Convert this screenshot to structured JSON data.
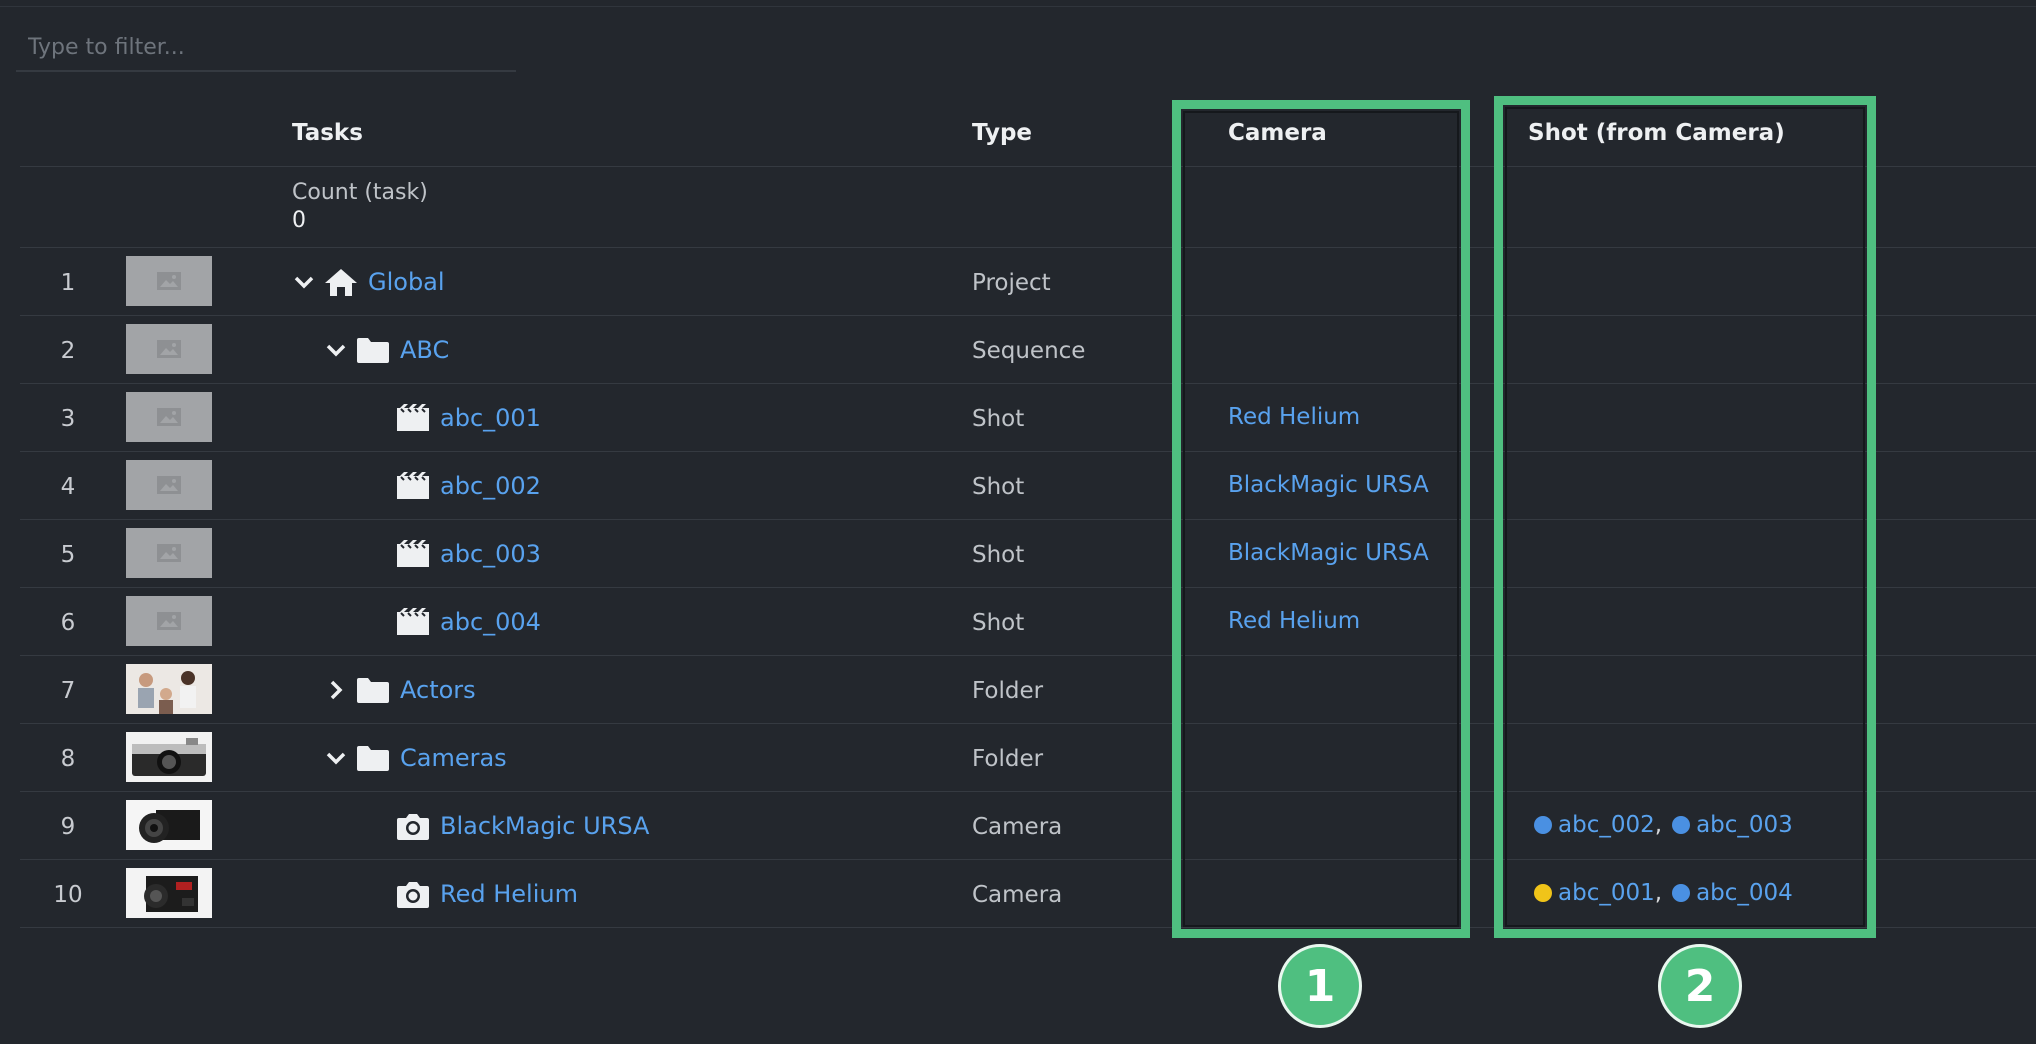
{
  "filter": {
    "placeholder": "Type to filter..."
  },
  "headers": {
    "tasks": "Tasks",
    "type": "Type",
    "camera": "Camera",
    "shot_from_camera": "Shot (from Camera)"
  },
  "summary": {
    "count_label": "Count (task)",
    "count_value": "0"
  },
  "rows": [
    {
      "num": "1",
      "name": "Global",
      "type": "Project",
      "icon": "home-icon",
      "chevron": "down",
      "camera": "",
      "shots": []
    },
    {
      "num": "2",
      "name": "ABC",
      "type": "Sequence",
      "icon": "folder-icon",
      "chevron": "down",
      "camera": "",
      "shots": []
    },
    {
      "num": "3",
      "name": "abc_001",
      "type": "Shot",
      "icon": "clapperboard-icon",
      "chevron": "",
      "camera": "Red Helium",
      "shots": []
    },
    {
      "num": "4",
      "name": "abc_002",
      "type": "Shot",
      "icon": "clapperboard-icon",
      "chevron": "",
      "camera": "BlackMagic URSA",
      "shots": []
    },
    {
      "num": "5",
      "name": "abc_003",
      "type": "Shot",
      "icon": "clapperboard-icon",
      "chevron": "",
      "camera": "BlackMagic URSA",
      "shots": []
    },
    {
      "num": "6",
      "name": "abc_004",
      "type": "Shot",
      "icon": "clapperboard-icon",
      "chevron": "",
      "camera": "Red Helium",
      "shots": []
    },
    {
      "num": "7",
      "name": "Actors",
      "type": "Folder",
      "icon": "folder-icon",
      "chevron": "right",
      "camera": "",
      "shots": []
    },
    {
      "num": "8",
      "name": "Cameras",
      "type": "Folder",
      "icon": "folder-icon",
      "chevron": "down",
      "camera": "",
      "shots": []
    },
    {
      "num": "9",
      "name": "BlackMagic URSA",
      "type": "Camera",
      "icon": "camera-icon",
      "chevron": "",
      "camera": "",
      "shots": [
        {
          "name": "abc_002",
          "status_color": "#4a90e2"
        },
        {
          "name": "abc_003",
          "status_color": "#4a90e2"
        }
      ]
    },
    {
      "num": "10",
      "name": "Red Helium",
      "type": "Camera",
      "icon": "camera-icon",
      "chevron": "",
      "camera": "",
      "shots": [
        {
          "name": "abc_001",
          "status_color": "#f0c419"
        },
        {
          "name": "abc_004",
          "status_color": "#4a90e2"
        }
      ]
    }
  ],
  "annotations": {
    "badge_1": "1",
    "badge_2": "2"
  },
  "colors": {
    "link": "#59a2ee",
    "highlight": "#4fbf80",
    "background": "#23272d"
  }
}
